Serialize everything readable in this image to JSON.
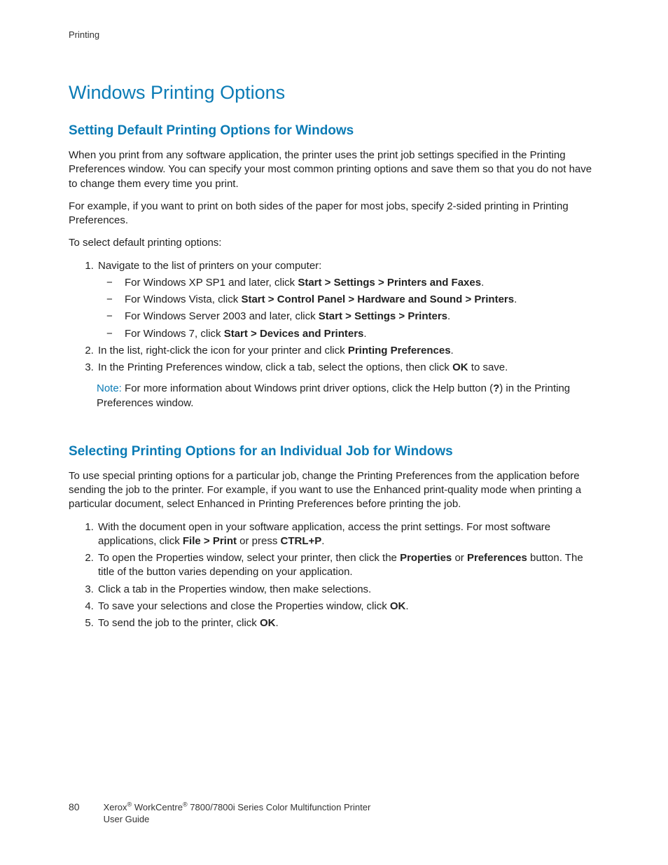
{
  "header": {
    "section": "Printing"
  },
  "title": "Windows Printing Options",
  "section1": {
    "heading": "Setting Default Printing Options for Windows",
    "p1": "When you print from any software application, the printer uses the print job settings specified in the Printing Preferences window. You can specify your most common printing options and save them so that you do not have to change them every time you print.",
    "p2": "For example, if you want to print on both sides of the paper for most jobs, specify 2-sided printing in Printing Preferences.",
    "p3": "To select default printing options:",
    "step1_intro": "Navigate to the list of printers on your computer:",
    "sub_xp_pre": "For Windows XP SP1 and later, click ",
    "sub_xp_bold": "Start > Settings > Printers and Faxes",
    "sub_vista_pre": "For Windows Vista, click ",
    "sub_vista_bold": "Start > Control Panel > Hardware and Sound > Printers",
    "sub_srv_pre": "For Windows Server 2003 and later, click ",
    "sub_srv_bold": "Start > Settings > Printers",
    "sub_w7_pre": "For Windows 7, click ",
    "sub_w7_bold": "Start > Devices and Printers",
    "step2_pre": "In the list, right-click the icon for your printer and click ",
    "step2_bold": "Printing Preferences",
    "step3_pre": "In the Printing Preferences window, click a tab, select the options, then click ",
    "step3_bold": "OK",
    "step3_post": " to save.",
    "note_label": "Note:",
    "note_pre": " For more information about Windows print driver options, click the Help button (",
    "note_q": "?",
    "note_post": ") in the Printing Preferences window."
  },
  "section2": {
    "heading": "Selecting Printing Options for an Individual Job for Windows",
    "p1": "To use special printing options for a particular job, change the Printing Preferences from the application before sending the job to the printer. For example, if you want to use the Enhanced print-quality mode when printing a particular document, select Enhanced in Printing Preferences before printing the job.",
    "s1_pre": "With the document open in your software application, access the print settings. For most software applications, click ",
    "s1_b1": "File > Print",
    "s1_mid": " or press ",
    "s1_b2": "CTRL+P",
    "s2_pre": "To open the Properties window, select your printer, then click the ",
    "s2_b1": "Properties",
    "s2_mid": " or ",
    "s2_b2": "Preferences",
    "s2_post": " button. The title of the button varies depending on your application.",
    "s3": "Click a tab in the Properties window, then make selections.",
    "s4_pre": "To save your selections and close the Properties window, click ",
    "s4_bold": "OK",
    "s5_pre": "To send the job to the printer, click ",
    "s5_bold": "OK"
  },
  "footer": {
    "page": "80",
    "brand1_pre": "Xerox",
    "brand1_sup": "®",
    "brand2_pre": " WorkCentre",
    "brand2_sup": "®",
    "line1_rest": " 7800/7800i Series Color Multifunction Printer",
    "line2": "User Guide"
  }
}
